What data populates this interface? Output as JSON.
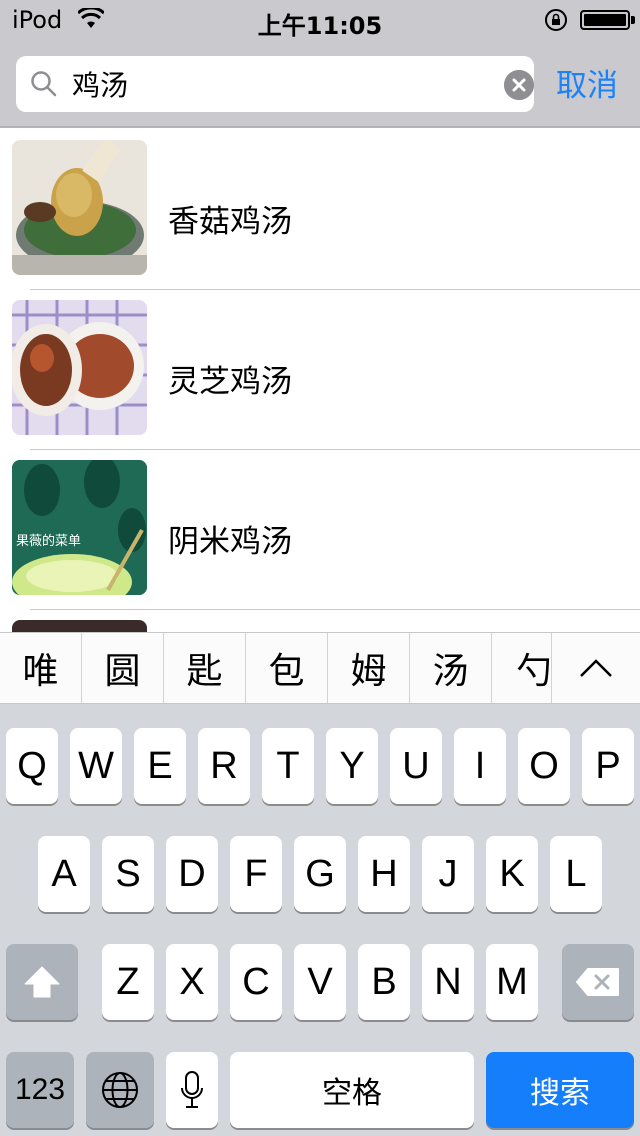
{
  "status_bar": {
    "carrier": "iPod",
    "time": "上午11:05"
  },
  "search": {
    "query": "鸡汤",
    "cancel_label": "取消"
  },
  "results": [
    {
      "title": "香菇鸡汤"
    },
    {
      "title": "灵芝鸡汤"
    },
    {
      "title": "阴米鸡汤",
      "thumb_caption": "果薇的菜单"
    }
  ],
  "candidates": [
    "唯",
    "圆",
    "匙",
    "包",
    "姆",
    "汤",
    "勺"
  ],
  "keyboard": {
    "row1": [
      "Q",
      "W",
      "E",
      "R",
      "T",
      "Y",
      "U",
      "I",
      "O",
      "P"
    ],
    "row2": [
      "A",
      "S",
      "D",
      "F",
      "G",
      "H",
      "J",
      "K",
      "L"
    ],
    "row3": [
      "Z",
      "X",
      "C",
      "V",
      "B",
      "N",
      "M"
    ],
    "numbers_label": "123",
    "space_label": "空格",
    "search_label": "搜索"
  },
  "colors": {
    "accent": "#1a82fb",
    "search_key": "#157efb",
    "header_bg": "#c9c9ce",
    "keyboard_bg": "#d3d6db"
  }
}
